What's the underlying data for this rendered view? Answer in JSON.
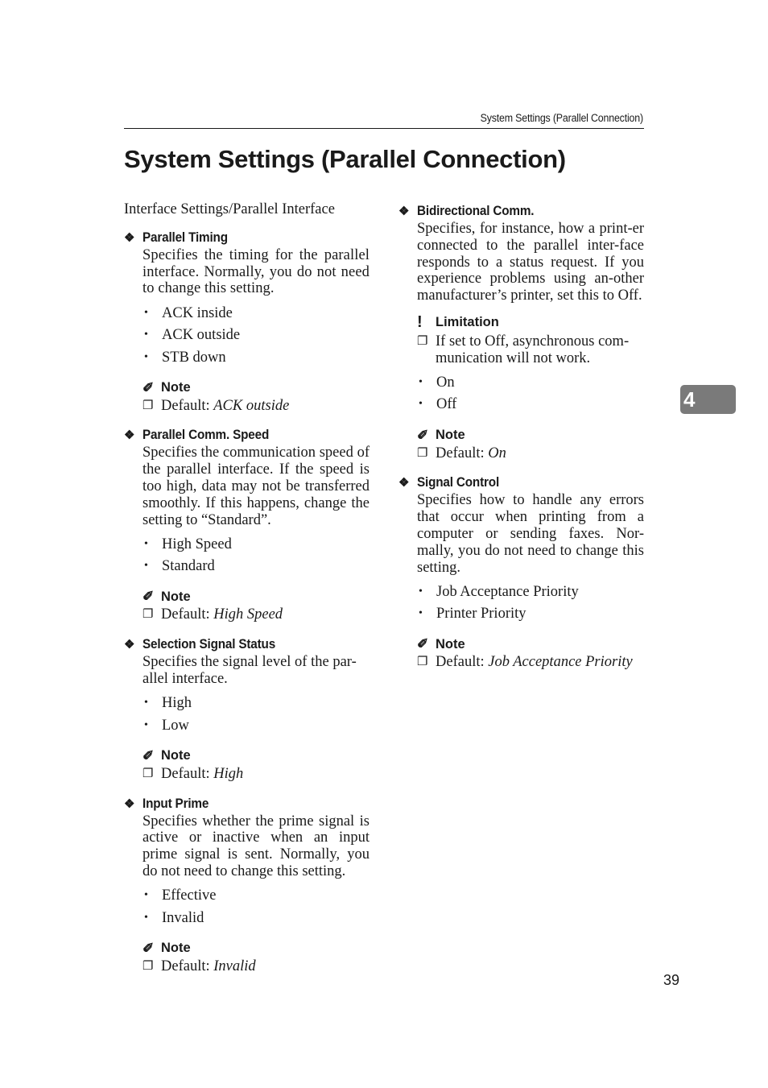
{
  "header": {
    "running_title": "System Settings (Parallel Connection)"
  },
  "page_title": "System Settings (Parallel Connection)",
  "intro": "Interface Settings/Parallel Interface",
  "icons": {
    "section": "❖",
    "note": "✐",
    "checkbox": "❐",
    "bullet": "•",
    "limitation": "!"
  },
  "labels": {
    "note": "Note",
    "limitation": "Limitation",
    "default_prefix": "Default: "
  },
  "left_sections": [
    {
      "title": "Parallel Timing",
      "description": "Specifies the timing for the parallel interface. Normally, you do not need to change this setting.",
      "options": [
        "ACK inside",
        "ACK outside",
        "STB down"
      ],
      "default": "ACK outside"
    },
    {
      "title": "Parallel Comm. Speed",
      "description": "Specifies the communication speed of the parallel interface. If the speed is too high, data may not be transferred smoothly. If this happens, change the setting to “Standard”.",
      "options": [
        "High Speed",
        "Standard"
      ],
      "default": "High Speed"
    },
    {
      "title": "Selection Signal Status",
      "description": "Specifies the signal level of the par-allel interface.",
      "options": [
        "High",
        "Low"
      ],
      "default": "High"
    },
    {
      "title": "Input Prime",
      "description": "Specifies whether the prime signal is active or inactive when an input prime signal is sent. Normally, you do not need to change this setting.",
      "options": [
        "Effective",
        "Invalid"
      ],
      "default": "Invalid"
    }
  ],
  "right_sections": [
    {
      "title": "Bidirectional Comm.",
      "description": "Specifies, for instance, how a print-er connected to the parallel inter-face responds to a status request. If you experience problems using an-other manufacturer’s printer, set this to Off.",
      "limitation": "If set to Off, asynchronous com-munication will not work.",
      "options": [
        "On",
        "Off"
      ],
      "default": "On"
    },
    {
      "title": "Signal Control",
      "description": "Specifies how to handle any errors that occur when printing from a computer or sending faxes. Nor-mally, you do not need to change this setting.",
      "options": [
        "Job Acceptance Priority",
        "Printer Priority"
      ],
      "default": "Job Acceptance Priority"
    }
  ],
  "chapter_tab": "4",
  "page_number": "39",
  "colors": {
    "chapter_tab_bg": "#7a7a7a",
    "text": "#1a1a1a"
  }
}
